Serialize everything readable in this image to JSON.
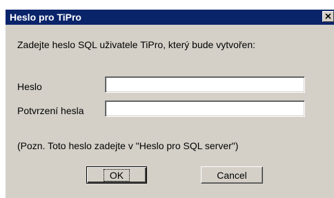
{
  "dialog": {
    "title": "Heslo pro TiPro",
    "instruction": "Zadejte heslo SQL uživatele TiPro, který bude vytvořen:",
    "note": "(Pozn. Toto heslo zadejte v \"Heslo pro SQL server\")"
  },
  "fields": {
    "password_label": "Heslo",
    "password_value": "",
    "confirm_label": "Potvrzení hesla",
    "confirm_value": ""
  },
  "buttons": {
    "ok_label": "OK",
    "cancel_label": "Cancel"
  },
  "titlebar": {
    "close_icon": "close-icon"
  },
  "colors": {
    "titlebar_bg": "#0a246a",
    "dialog_bg": "#d4d0c8"
  }
}
